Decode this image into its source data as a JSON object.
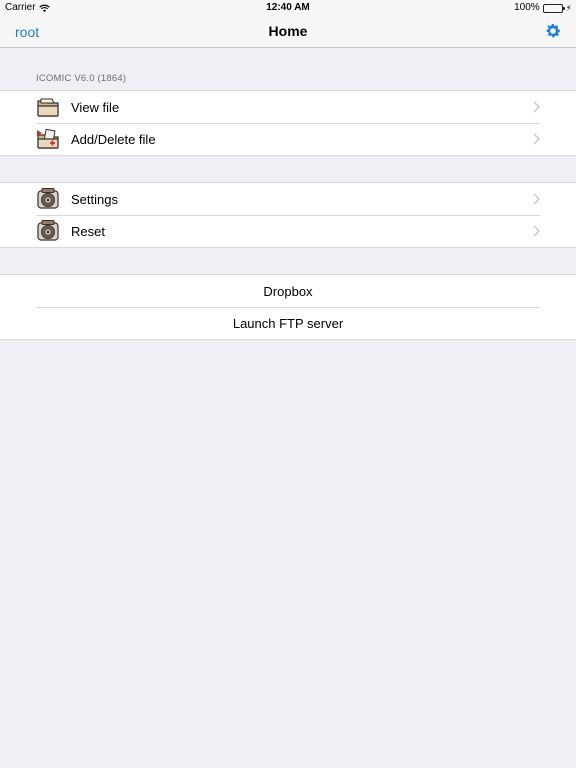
{
  "status_bar": {
    "carrier": "Carrier",
    "time": "12:40 AM",
    "battery": "100%",
    "wifi_icon": "wifi-icon",
    "battery_icon": "battery-icon",
    "charging_icon": "bolt-icon"
  },
  "nav": {
    "back_label": "root",
    "title": "Home",
    "right_icon": "gear-icon",
    "accent_color": "#1b7ee0"
  },
  "section1": {
    "header": "ICOMIC V6.0 (1864)",
    "items": [
      {
        "label": "View file",
        "icon": "folder-icon"
      },
      {
        "label": "Add/Delete file",
        "icon": "folder-edit-icon"
      }
    ]
  },
  "section2": {
    "items": [
      {
        "label": "Settings",
        "icon": "settings-machine-icon"
      },
      {
        "label": "Reset",
        "icon": "reset-machine-icon"
      }
    ]
  },
  "section3": {
    "items": [
      {
        "label": "Dropbox"
      },
      {
        "label": "Launch FTP server"
      }
    ]
  }
}
